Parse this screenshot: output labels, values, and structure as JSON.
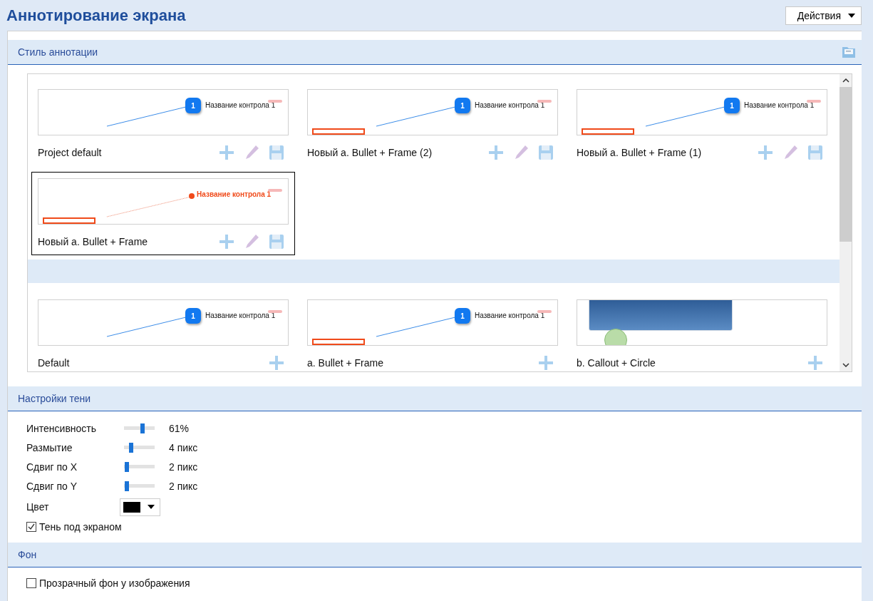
{
  "title": "Аннотирование экрана",
  "actions_button": {
    "label": "Действия"
  },
  "style_section": {
    "title": "Стиль аннотации",
    "groups": [
      {
        "styles": [
          {
            "name": "Project default",
            "kind": "bullet",
            "preview_label": "Название контрола 1",
            "badge": "1",
            "editable": true,
            "selected": false
          },
          {
            "name": "Новый a. Bullet + Frame (2)",
            "kind": "bullet_frame",
            "preview_label": "Название контрола 1",
            "badge": "1",
            "editable": true,
            "selected": false
          },
          {
            "name": "Новый a. Bullet + Frame (1)",
            "kind": "bullet_frame",
            "preview_label": "Название контрола 1",
            "badge": "1",
            "editable": true,
            "selected": false
          },
          {
            "name": "Новый a. Bullet + Frame",
            "kind": "dot_frame",
            "preview_label": "Название контрола 1",
            "editable": true,
            "selected": true
          }
        ]
      },
      {
        "styles": [
          {
            "name": "Default",
            "kind": "bullet",
            "preview_label": "Название контрола 1",
            "badge": "1",
            "editable": false,
            "selected": false
          },
          {
            "name": "a. Bullet + Frame",
            "kind": "bullet_frame",
            "preview_label": "Название контрола 1",
            "badge": "1",
            "editable": false,
            "selected": false
          },
          {
            "name": "b. Callout + Circle",
            "kind": "callout",
            "editable": false,
            "selected": false
          }
        ]
      }
    ]
  },
  "shadow_section": {
    "title": "Настройки тени",
    "sliders": [
      {
        "label": "Интенсивность",
        "level": 0.61,
        "reading": "61%"
      },
      {
        "label": "Размытие",
        "level": 0.2,
        "reading": "4 пикс"
      },
      {
        "label": "Сдвиг по X",
        "level": 0.02,
        "reading": "2 пикс"
      },
      {
        "label": "Сдвиг по Y",
        "level": 0.02,
        "reading": "2 пикс"
      }
    ],
    "color": {
      "label": "Цвет",
      "color": "#000000"
    },
    "screen_shadow": {
      "label": "Тень под экраном",
      "checked": true
    }
  },
  "background_section": {
    "title": "Фон",
    "transparent": {
      "label": "Прозрачный фон у изображения",
      "checked": false
    }
  }
}
